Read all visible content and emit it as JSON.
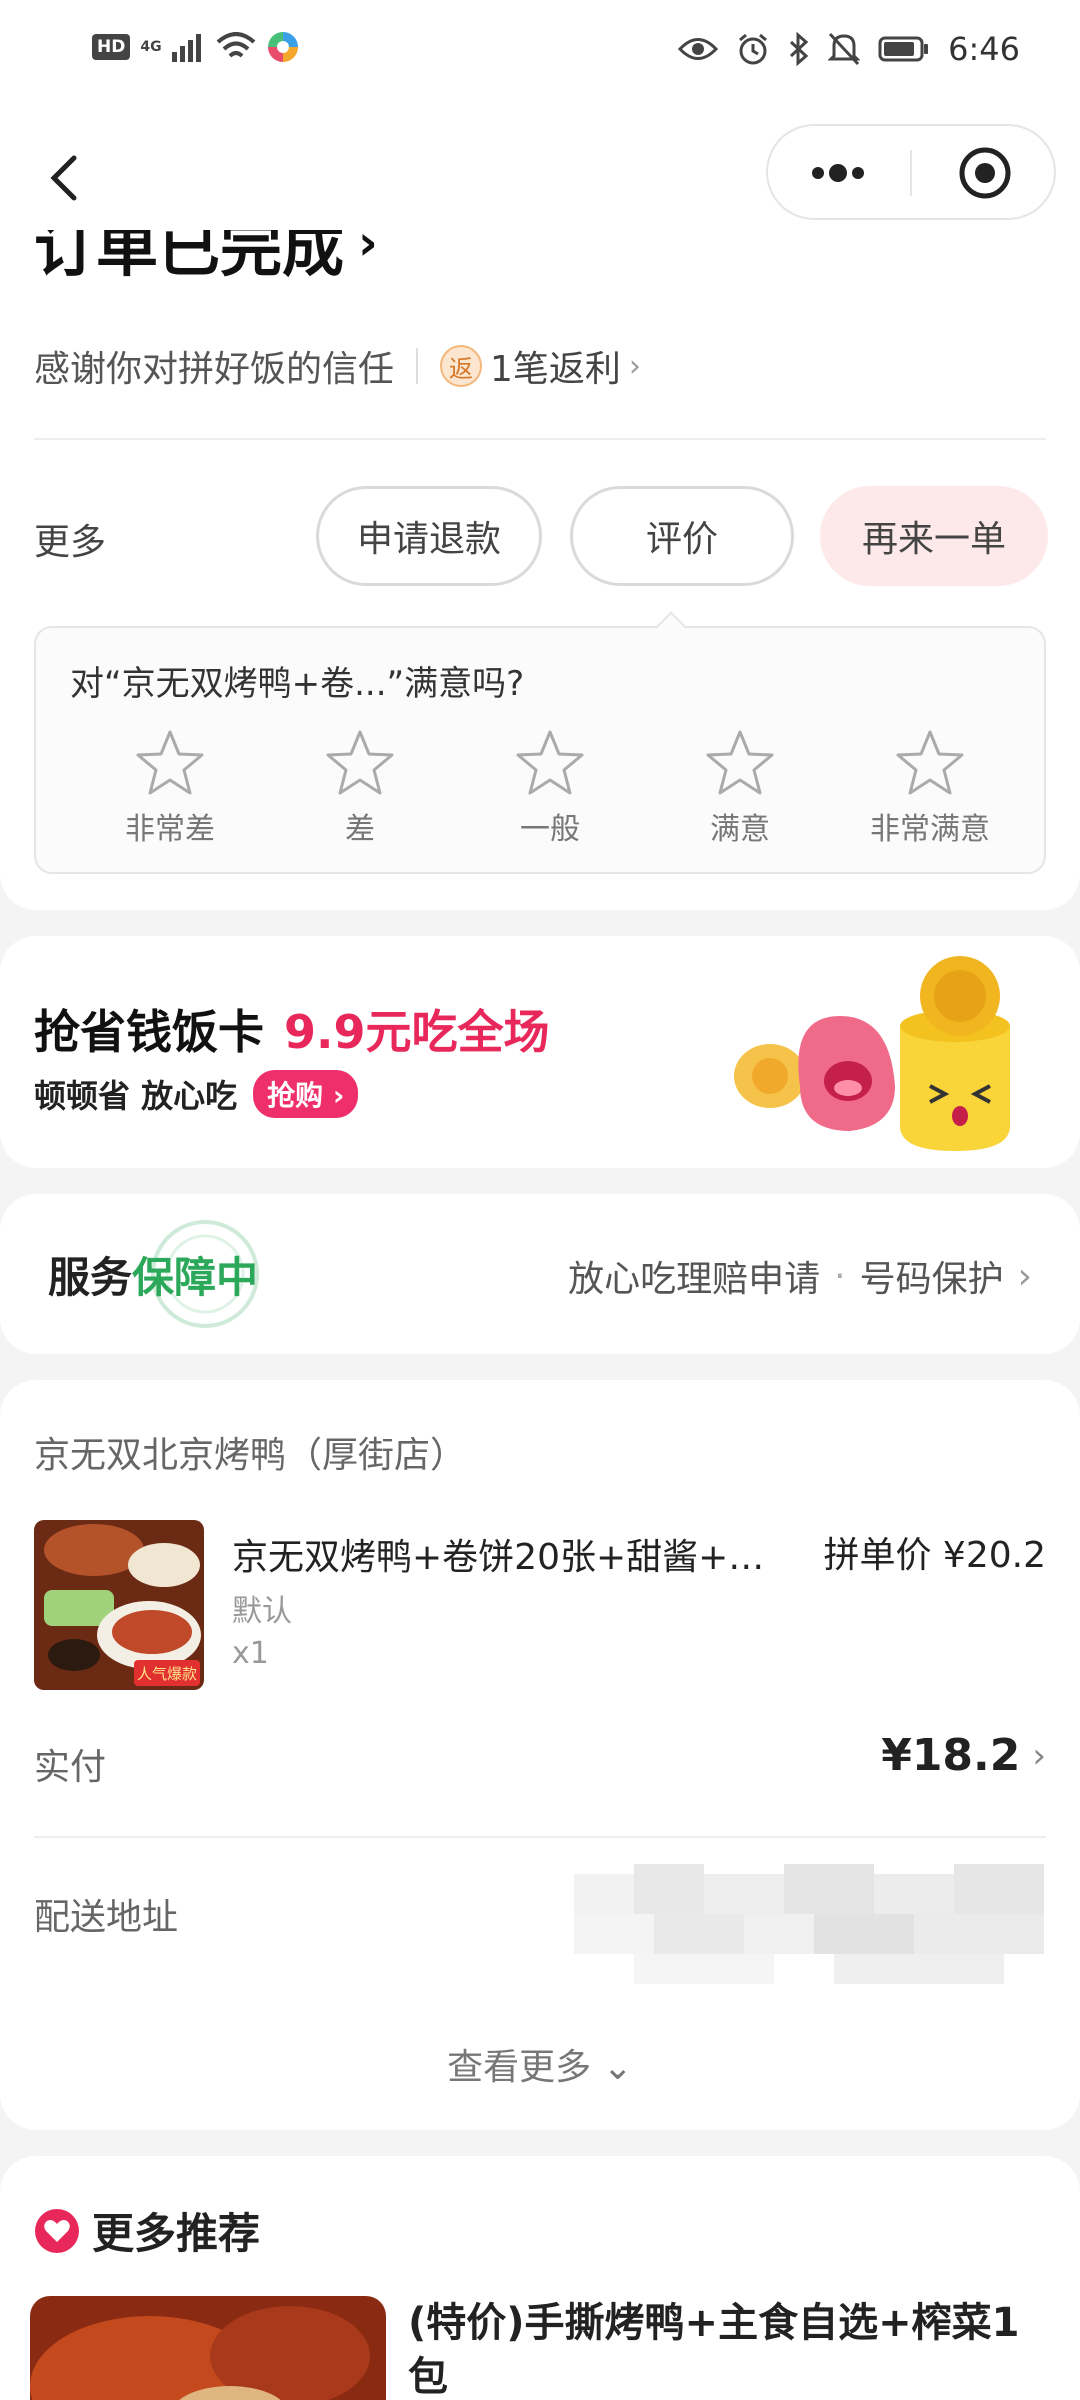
{
  "status_bar": {
    "left_badge": "HD",
    "network": "4G",
    "time": "6:46",
    "icons": [
      "hd-icon",
      "signal-icon",
      "wifi-icon",
      "app-icon",
      "eye-icon",
      "alarm-icon",
      "bluetooth-icon",
      "mute-icon",
      "battery-icon"
    ]
  },
  "nav": {
    "back_icon": "chevron-left-icon",
    "menu_icon": "more-dots-icon",
    "close_icon": "target-icon"
  },
  "order": {
    "title": "订单已完成",
    "thanks_text": "感谢你对拼好饭的信任",
    "rebate_badge": "返",
    "rebate_text": "1笔返利",
    "more_label": "更多",
    "actions": {
      "refund": "申请退款",
      "review": "评价",
      "reorder": "再来一单"
    },
    "rating": {
      "question": "对“京无双烤鸭+卷...”满意吗?",
      "levels": [
        "非常差",
        "差",
        "一般",
        "满意",
        "非常满意"
      ]
    }
  },
  "promo": {
    "title": "抢省钱饭卡",
    "highlight": "9.9元吃全场",
    "subtitle": "顿顿省 放心吃",
    "buy_label": "抢购"
  },
  "service": {
    "prefix": "服务",
    "status": "保障中",
    "link1": "放心吃理赔申请",
    "dot": "·",
    "link2": "号码保护"
  },
  "order_detail": {
    "shop_name": "京无双北京烤鸭（厚街店）",
    "product": {
      "name": "京无双烤鸭+卷饼20张+甜酱+…",
      "price_label": "拼单价 ¥20.2",
      "spec": "默认",
      "qty": "x1",
      "image_badge": "人气爆款"
    },
    "paid_label": "实付",
    "paid_value": "¥18.2",
    "address_label": "配送地址",
    "view_more": "查看更多"
  },
  "recommend": {
    "heading": "更多推荐",
    "item_title": "(特价)手撕烤鸭+主食自选+榨菜1包"
  },
  "colors": {
    "accent_pink": "#ee2f6c",
    "service_green": "#2ca85a",
    "reorder_bg": "#fde8ea"
  }
}
